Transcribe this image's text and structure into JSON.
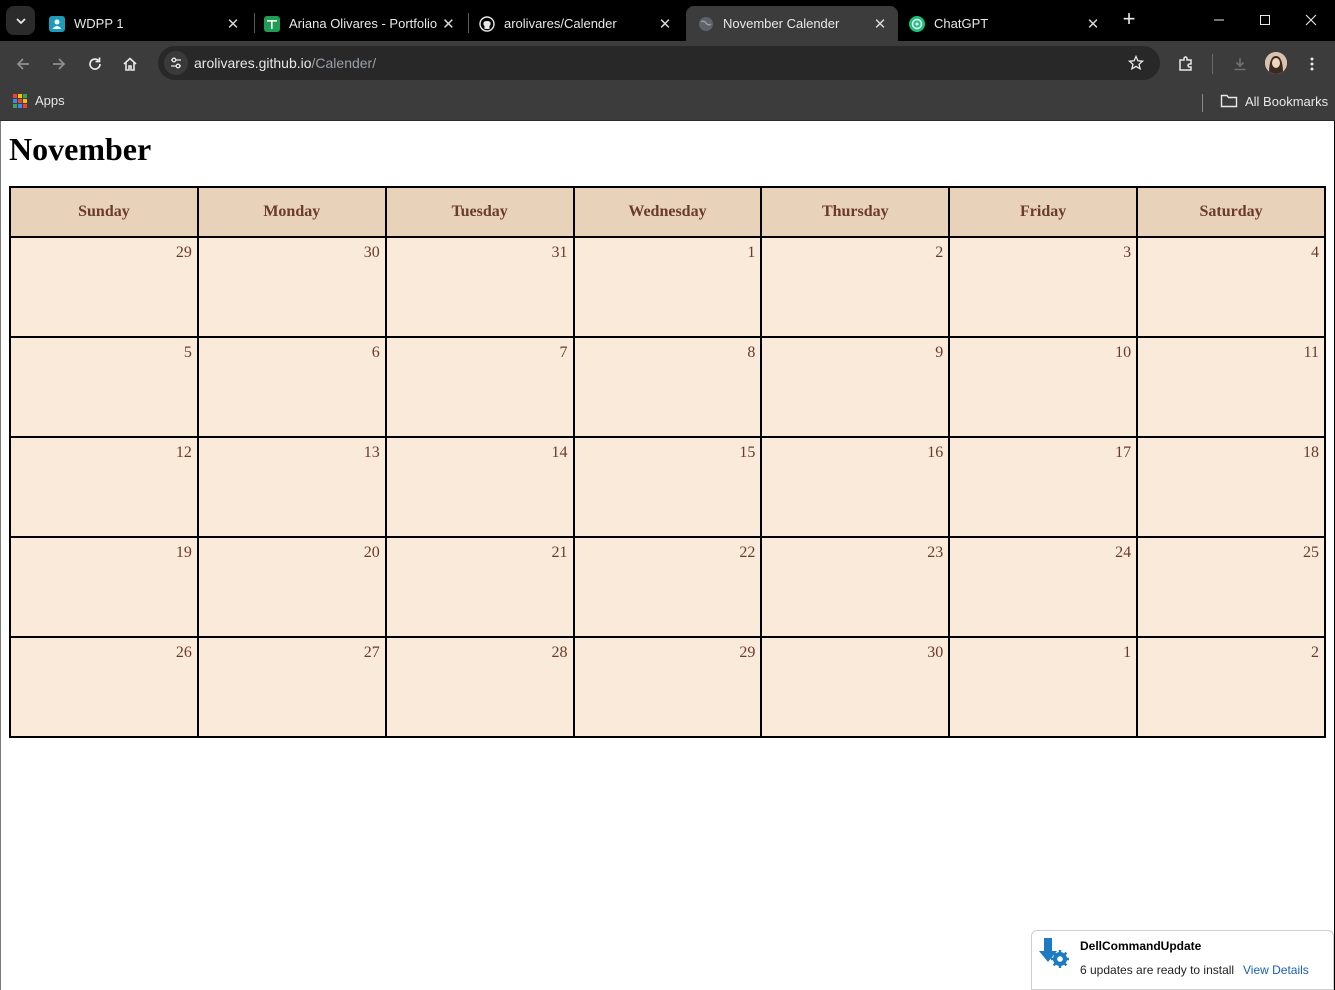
{
  "browser": {
    "tabs": [
      {
        "title": "WDPP 1",
        "icon": "classroom-icon",
        "active": false
      },
      {
        "title": "Ariana Olivares - Portfolio (",
        "icon": "sheets-icon",
        "active": false
      },
      {
        "title": "arolivares/Calender",
        "icon": "github-icon",
        "active": false
      },
      {
        "title": "November Calender",
        "icon": "globe-icon",
        "active": true
      },
      {
        "title": "ChatGPT",
        "icon": "chatgpt-icon",
        "active": false
      }
    ],
    "url_host": "arolivares.github.io",
    "url_path": "/Calender/",
    "bookmarks": {
      "apps_label": "Apps",
      "all_label": "All Bookmarks"
    }
  },
  "page": {
    "month_title": "November",
    "weekdays": [
      "Sunday",
      "Monday",
      "Tuesday",
      "Wednesday",
      "Thursday",
      "Friday",
      "Saturday"
    ],
    "weeks": [
      [
        "29",
        "30",
        "31",
        "1",
        "2",
        "3",
        "4"
      ],
      [
        "5",
        "6",
        "7",
        "8",
        "9",
        "10",
        "11"
      ],
      [
        "12",
        "13",
        "14",
        "15",
        "16",
        "17",
        "18"
      ],
      [
        "19",
        "20",
        "21",
        "22",
        "23",
        "24",
        "25"
      ],
      [
        "26",
        "27",
        "28",
        "29",
        "30",
        "1",
        "2"
      ]
    ],
    "colors": {
      "header_bg": "#e8d2b9",
      "cell_bg": "#f9eada",
      "text": "#6b3a2a"
    }
  },
  "notification": {
    "title": "DellCommandUpdate",
    "message": "6 updates are ready to install",
    "link": "View Details"
  }
}
